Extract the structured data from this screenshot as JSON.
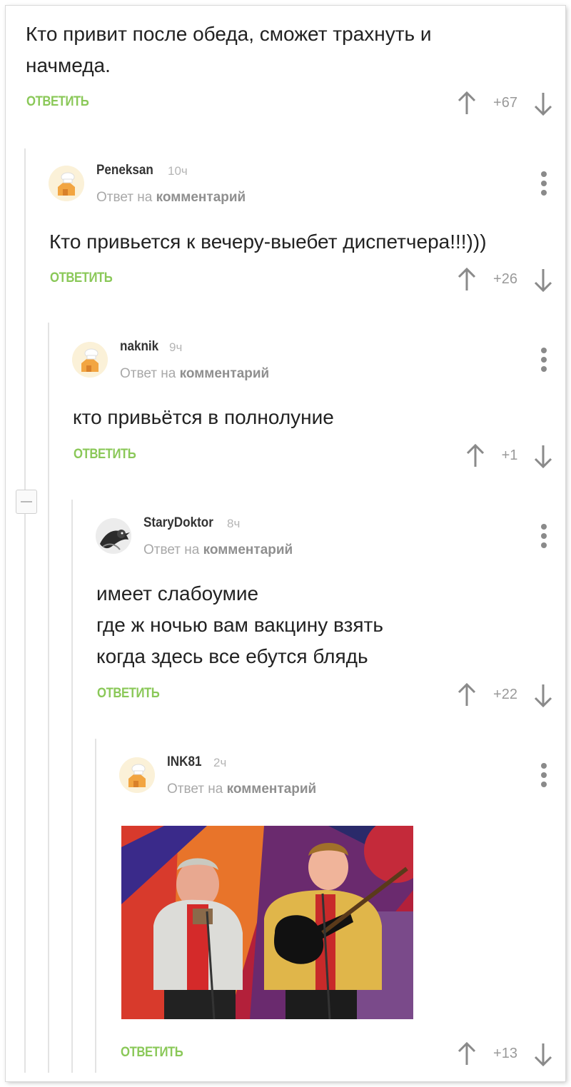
{
  "comments": [
    {
      "text": "Кто привит после обеда,  сможет трахнуть и\nначмеда.",
      "reply_label": "ОТВЕТИТЬ",
      "score": "+67"
    },
    {
      "username": "Peneksan",
      "time": "10ч",
      "reply_to_prefix": "Ответ на",
      "reply_to_link": "комментарий",
      "avatar": "chef-house-avatar",
      "text": "Кто привьется к вечеру-выебет диспетчера!!!)))",
      "reply_label": "ОТВЕТИТЬ",
      "score": "+26"
    },
    {
      "username": "naknik",
      "time": "9ч",
      "reply_to_prefix": "Ответ на",
      "reply_to_link": "комментарий",
      "avatar": "chef-house-avatar",
      "text": "кто привьётся в полнолуние",
      "reply_label": "ОТВЕТИТЬ",
      "score": "+1"
    },
    {
      "username": "StaryDoktor",
      "time": "8ч",
      "reply_to_prefix": "Ответ на",
      "reply_to_link": "комментарий",
      "avatar": "bird-photo-avatar",
      "text": "имеет слабоумие\nгде ж ночью вам вакцину взять\nкогда здесь все ебутся блядь",
      "reply_label": "ОТВЕТИТЬ",
      "score": "+22"
    },
    {
      "username": "INK81",
      "time": "2ч",
      "reply_to_prefix": "Ответ на",
      "reply_to_link": "комментарий",
      "avatar": "chef-house-avatar",
      "image": "two-singers-with-guitar-and-accordion-photo",
      "reply_label": "ОТВЕТИТЬ",
      "score": "+13"
    }
  ],
  "colors": {
    "reply_green": "#8ac858",
    "meta_grey": "#a8a8a8",
    "thread_line": "#e3e3e3"
  },
  "icons": [
    "upvote-arrow-icon",
    "downvote-arrow-icon",
    "more-options-icon",
    "collapse-thread-icon"
  ]
}
